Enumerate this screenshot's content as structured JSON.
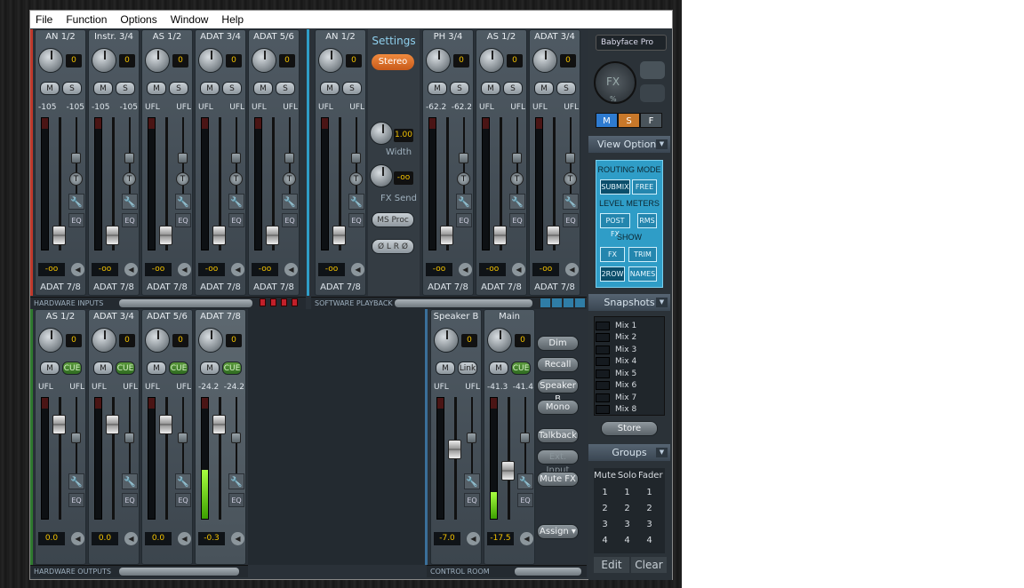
{
  "menu": [
    "File",
    "Function",
    "Options",
    "Window",
    "Help"
  ],
  "hardware_inputs": [
    {
      "name": "AN 1/2",
      "gain": "0",
      "level": [
        "-105",
        "-105"
      ],
      "readout": "-oo",
      "route": "ADAT 7/8"
    },
    {
      "name": "Instr. 3/4",
      "gain": "0",
      "level": [
        "-105",
        "-105"
      ],
      "readout": "-oo",
      "route": "ADAT 7/8"
    },
    {
      "name": "AS 1/2",
      "gain": "0",
      "level": [
        "UFL",
        "UFL"
      ],
      "readout": "-oo",
      "route": "ADAT 7/8"
    },
    {
      "name": "ADAT 3/4",
      "gain": "0",
      "level": [
        "UFL",
        "UFL"
      ],
      "readout": "-oo",
      "route": "ADAT 7/8"
    },
    {
      "name": "ADAT 5/6",
      "gain": "0",
      "level": [
        "UFL",
        "UFL"
      ],
      "readout": "-oo",
      "route": "ADAT 7/8"
    }
  ],
  "software_playback": [
    {
      "name": "AN 1/2",
      "gain": "0",
      "level": [
        "UFL",
        "UFL"
      ],
      "readout": "-oo",
      "route": "ADAT 7/8"
    },
    {
      "name": "PH 3/4",
      "gain": "0",
      "level": [
        "-62.2",
        "-62.2"
      ],
      "readout": "-oo",
      "route": "ADAT 7/8"
    },
    {
      "name": "AS 1/2",
      "gain": "0",
      "level": [
        "UFL",
        "UFL"
      ],
      "readout": "-oo",
      "route": "ADAT 7/8"
    },
    {
      "name": "ADAT 3/4",
      "gain": "0",
      "level": [
        "UFL",
        "UFL"
      ],
      "readout": "-oo",
      "route": "ADAT 7/8"
    }
  ],
  "settings": {
    "title": "Settings",
    "stereo": "Stereo",
    "width_value": "1.00",
    "width_label": "Width",
    "fxsend_value": "-oo",
    "fxsend_label": "FX Send",
    "ms_proc": "MS Proc",
    "phase": "Ø L  R Ø"
  },
  "hardware_outputs": [
    {
      "name": "AS 1/2",
      "gain": "0",
      "level": [
        "UFL",
        "UFL"
      ],
      "readout": "0.0",
      "meter": 0
    },
    {
      "name": "ADAT 3/4",
      "gain": "0",
      "level": [
        "UFL",
        "UFL"
      ],
      "readout": "0.0",
      "meter": 0
    },
    {
      "name": "ADAT 5/6",
      "gain": "0",
      "level": [
        "UFL",
        "UFL"
      ],
      "readout": "0.0",
      "meter": 0
    },
    {
      "name": "ADAT 7/8",
      "gain": "0",
      "level": [
        "-24.2",
        "-24.2"
      ],
      "readout": "-0.3",
      "meter": 0.4
    }
  ],
  "control_room": [
    {
      "name": "Speaker B",
      "gain": "0",
      "level": [
        "UFL",
        "UFL"
      ],
      "readout": "-7.0",
      "btn2": "Link",
      "meter": 0
    },
    {
      "name": "Main",
      "gain": "0",
      "level": [
        "-41.3",
        "-41.4"
      ],
      "readout": "-17.5",
      "btn2": "CUE",
      "meter": 0.22
    }
  ],
  "room_buttons": [
    "Dim",
    "Recall",
    "Speaker B",
    "Mono",
    "Talkback",
    "Ext. Input",
    "Mute FX",
    "Assign ▾"
  ],
  "labels": {
    "m": "M",
    "s": "S",
    "t": "T",
    "eq": "EQ",
    "cue": "CUE",
    "wrench": "🔧",
    "arrow": "◀",
    "hw_in": "HARDWARE INPUTS",
    "sw_play": "SOFTWARE PLAYBACK",
    "hw_out": "HARDWARE OUTPUTS",
    "ctrl": "CONTROL ROOM"
  },
  "device": {
    "name": "Babyface Pro",
    "fx": "FX",
    "pct": "%",
    "msf": [
      "M",
      "S",
      "F"
    ]
  },
  "view_options": {
    "title": "View Options",
    "routing_mode": "ROUTING MODE",
    "submix": "SUBMIX",
    "free": "FREE",
    "level_meters": "LEVEL METERS",
    "postfx": "POST FX",
    "rms": "RMS",
    "show": "SHOW",
    "fx": "FX",
    "trim": "TRIM",
    "row2": "2ROW",
    "names": "NAMES"
  },
  "snapshots": {
    "title": "Snapshots",
    "mixes": [
      "Mix 1",
      "Mix 2",
      "Mix 3",
      "Mix 4",
      "Mix 5",
      "Mix 6",
      "Mix 7",
      "Mix 8"
    ],
    "store": "Store"
  },
  "groups": {
    "title": "Groups",
    "cols": [
      "Mute",
      "Solo",
      "Fader"
    ],
    "rows": [
      "1",
      "2",
      "3",
      "4"
    ],
    "edit": "Edit",
    "clear": "Clear"
  },
  "colors": {
    "accent": "#2f9dc7",
    "orange": "#e0702a",
    "level_yellow": "#f3c200",
    "meter_green": "#a8ff40"
  }
}
